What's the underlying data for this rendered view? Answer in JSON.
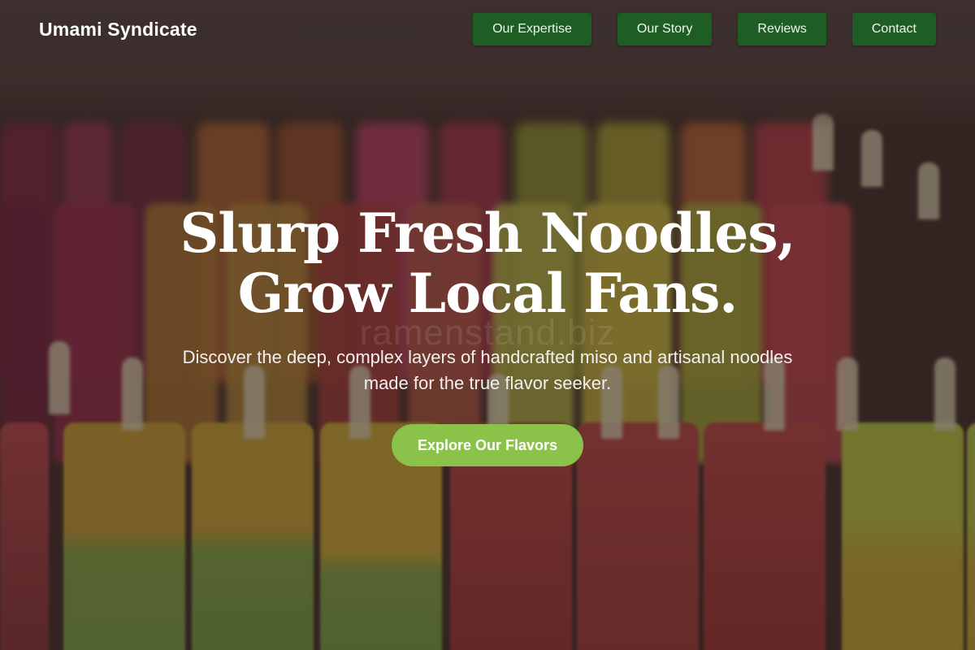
{
  "header": {
    "brand": "Umami Syndicate",
    "nav": [
      {
        "label": "Our Expertise"
      },
      {
        "label": "Our Story"
      },
      {
        "label": "Reviews"
      },
      {
        "label": "Contact"
      }
    ]
  },
  "hero": {
    "headline_line1": "Slurp Fresh Noodles,",
    "headline_line2": "Grow Local Fans.",
    "watermark": "ramenstand.biz",
    "subtitle_line1": "Discover the deep, complex layers of handcrafted miso and artisanal noodles",
    "subtitle_line2": "made for the true flavor seeker.",
    "cta_label": "Explore Our Flavors"
  },
  "colors": {
    "nav_button": "#1e5e24",
    "cta_button": "#8bc34a",
    "text": "#ffffff"
  }
}
